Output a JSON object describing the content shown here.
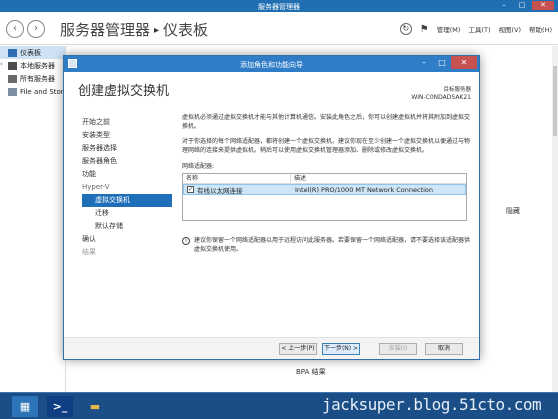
{
  "server_manager": {
    "title": "服务器管理器",
    "breadcrumb": [
      "服务器管理器",
      "仪表板"
    ],
    "breadcrumb_sep": "▸",
    "menu": [
      "管理(M)",
      "工具(T)",
      "视图(V)",
      "帮助(H)"
    ],
    "sidebar": [
      {
        "label": "仪表板",
        "icon": "dashboard-icon",
        "active": true
      },
      {
        "label": "本地服务器",
        "icon": "server-icon",
        "active": false
      },
      {
        "label": "所有服务器",
        "icon": "servers-icon",
        "active": false
      },
      {
        "label": "File and Stor",
        "icon": "file-storage-icon",
        "active": false
      }
    ],
    "hide_label": "隐藏",
    "bpa_label": "BPA 结果"
  },
  "wizard": {
    "title": "添加角色和功能向导",
    "heading": "创建虚拟交换机",
    "destination_label": "目标服务器",
    "destination_server": "WIN-C0NDADSAK21",
    "nav": [
      {
        "label": "开始之前",
        "kind": "normal"
      },
      {
        "label": "安装类型",
        "kind": "normal"
      },
      {
        "label": "服务器选择",
        "kind": "normal"
      },
      {
        "label": "服务器角色",
        "kind": "normal"
      },
      {
        "label": "功能",
        "kind": "normal"
      },
      {
        "label": "Hyper-V",
        "kind": "group"
      },
      {
        "label": "虚拟交换机",
        "kind": "current"
      },
      {
        "label": "迁移",
        "kind": "sub"
      },
      {
        "label": "默认存储",
        "kind": "sub"
      },
      {
        "label": "确认",
        "kind": "normal"
      },
      {
        "label": "结果",
        "kind": "disabled"
      }
    ],
    "para1": "虚拟机必须通过虚拟交换机才能与其他计算机通信。安装此角色之后，你可以创建虚拟机并将其附加到虚拟交换机。",
    "para2": "对于你选择的每个网络适配器，都将创建一个虚拟交换机。建议你现在至少创建一个虚拟交换机以便通过与物理网络的连接来提供虚拟机。稍后可以使用虚拟交换机管理器添加、删除或修改虚拟交换机。",
    "adapters_label": "网络适配器:",
    "grid": {
      "headers": [
        "名称",
        "描述"
      ],
      "rows": [
        {
          "checked": true,
          "name": "有线以太网连接",
          "description": "Intel(R) PRO/1000 MT Network Connection"
        }
      ]
    },
    "info": "建议你保留一个网络适配器以用于远程访问此服务器。若要保留一个网络适配器，请不要选择该适配器供虚拟交换机使用。",
    "buttons": {
      "prev": "< 上一步(P)",
      "next": "下一步(N) >",
      "install": "安装(I)",
      "cancel": "取消"
    }
  },
  "taskbar": {
    "watermark": "jacksuper.blog.51cto.com"
  },
  "colors": {
    "titlebar": "#1f6fb2",
    "wizard_titlebar": "#2f7cc7",
    "nav_current": "#1f6fb8",
    "taskbar": "#1b4e86",
    "close_button": "#c75050"
  }
}
